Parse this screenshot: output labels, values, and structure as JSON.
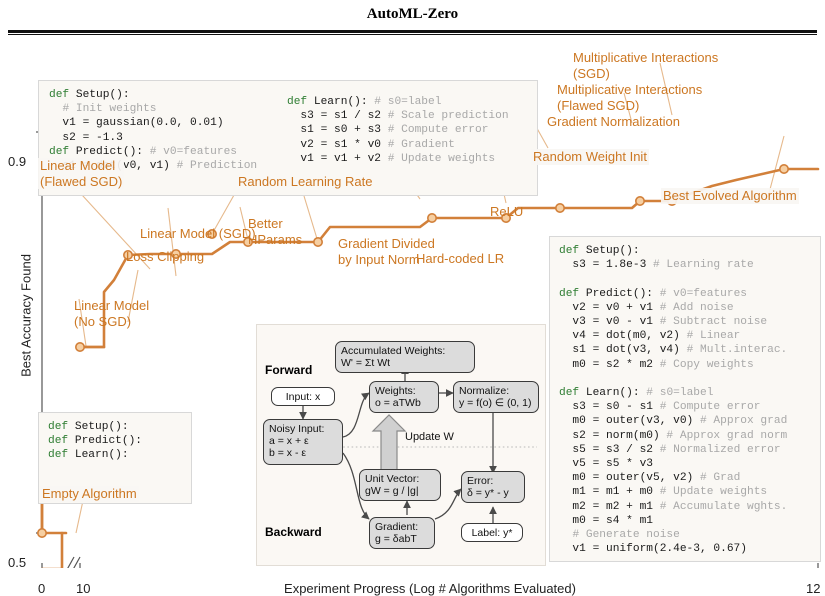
{
  "paper": {
    "title": "AutoML-Zero"
  },
  "axes": {
    "y_label": "Best Accuracy Found",
    "y_ticks": [
      "0.9",
      "0.5"
    ],
    "y_high": "0.9",
    "y_low": "0.5",
    "x_label": "Experiment Progress (Log # Algorithms Evaluated)",
    "x_tick_0": "0",
    "x_tick_10": "10",
    "x_tick_12": "12",
    "break_marker": "//"
  },
  "chart_data": {
    "type": "line",
    "title": "AutoML-Zero",
    "xlabel": "Experiment Progress (Log # Algorithms Evaluated)",
    "ylabel": "Best Accuracy Found",
    "xlim": [
      0,
      12
    ],
    "ylim": [
      0.5,
      0.9
    ],
    "grid": false,
    "legend": "none",
    "series": [
      {
        "name": "Best Accuracy Found",
        "color": "#d2803a",
        "x": [
          0.0,
          0.3,
          1.2,
          1.55,
          2.05,
          2.3,
          2.6,
          3.05,
          3.45,
          5.05,
          5.4,
          6.0,
          6.45,
          7.1,
          7.55,
          8.6,
          9.1,
          9.8,
          10.2,
          10.55,
          11.1,
          11.6,
          12.0
        ],
        "y": [
          0.5,
          0.5,
          0.618,
          0.618,
          0.66,
          0.672,
          0.735,
          0.735,
          0.736,
          0.736,
          0.759,
          0.759,
          0.773,
          0.773,
          0.781,
          0.781,
          0.806,
          0.83,
          0.838,
          0.845,
          0.845,
          0.87,
          0.87
        ],
        "markers_x": [
          0.0,
          1.2,
          2.05,
          2.3,
          2.6,
          5.05,
          6.0,
          7.1,
          8.6,
          9.1,
          9.8,
          10.55,
          11.1
        ],
        "markers_y": [
          0.5,
          0.618,
          0.66,
          0.672,
          0.735,
          0.736,
          0.759,
          0.773,
          0.781,
          0.806,
          0.83,
          0.845,
          0.87
        ]
      }
    ],
    "annotations": [
      "Linear Model (Flawed SGD)",
      "Linear Model (No SGD)",
      "Loss Clipping",
      "Linear Model (SGD)",
      "Better HParams",
      "Random Learning Rate",
      "Gradient Divided by Input Norm",
      "Hard-coded LR",
      "ReLU",
      "Random Weight Init",
      "Gradient Normalization",
      "Multiplicative Interactions (Flawed SGD)",
      "Multiplicative Interactions (SGD)",
      "Best Evolved Algorithm",
      "Empty Algorithm"
    ]
  },
  "annotations": {
    "linear_flawed_l1": "Linear Model",
    "linear_flawed_l2": "(Flawed SGD)",
    "linear_nosgd_l1": "Linear Model",
    "linear_nosgd_l2": "(No SGD)",
    "loss_clipping": "Loss Clipping",
    "linear_sgd": "Linear Model (SGD)",
    "better_hparams_l1": "Better",
    "better_hparams_l2": "HParams",
    "random_lr": "Random Learning Rate",
    "grad_div_l1": "Gradient Divided",
    "grad_div_l2": "by Input Norm",
    "hardcoded_lr": "Hard-coded LR",
    "relu": "ReLU",
    "random_weight_init": "Random Weight Init",
    "gradient_normalization": "Gradient Normalization",
    "mult_flawed_l1": "Multiplicative Interactions",
    "mult_flawed_l2": "(Flawed SGD)",
    "mult_sgd_l1": "Multiplicative Interactions",
    "mult_sgd_l2": "(SGD)",
    "best_evolved": "Best Evolved Algorithm",
    "empty_algorithm": "Empty Algorithm"
  },
  "code": {
    "top_left": "def Setup():\n  # Init weights\n  v1 = gaussian(0.0, 0.01)\n  s2 = -1.3\ndef Predict(): # v0=features\n  s1 = dot(v0, v1) # Prediction",
    "top_right": "def Learn(): # s0=label\n  s3 = s1 / s2 # Scale prediction\n  s1 = s0 + s3 # Compute error\n  v2 = s1 * v0 # Gradient\n  v1 = v1 + v2 # Update weights",
    "empty": "def Setup():\ndef Predict():\ndef Learn():",
    "best": "def Setup():\n  s3 = 1.8e-3 # Learning rate\n\ndef Predict(): # v0=features\n  v2 = v0 + v1 # Add noise\n  v3 = v0 - v1 # Subtract noise\n  v4 = dot(m0, v2) # Linear\n  s1 = dot(v3, v4) # Mult.interac.\n  m0 = s2 * m2 # Copy weights\n\ndef Learn(): # s0=label\n  s3 = s0 - s1 # Compute error\n  m0 = outer(v3, v0) # Approx grad\n  s2 = norm(m0) # Approx grad norm\n  s5 = s3 / s2 # Normalized error\n  v5 = s5 * v3\n  m0 = outer(v5, v2) # Grad\n  m1 = m1 + m0 # Update weights\n  m2 = m2 + m1 # Accumulate wghts.\n  m0 = s4 * m1\n  # Generate noise\n  v1 = uniform(2.4e-3, 0.67)"
  },
  "diagram": {
    "forward_label": "Forward",
    "backward_label": "Backward",
    "update_label": "Update W",
    "nodes": {
      "accumulated_weights_t": "Accumulated Weights:",
      "accumulated_weights_f": "W' = Σt Wt",
      "input": "Input: x",
      "noisy_t": "Noisy Input:",
      "noisy_f1": "a = x + ε",
      "noisy_f2": "b = x - ε",
      "weights_t": "Weights:",
      "weights_f": "o = aTWb",
      "normalize_t": "Normalize:",
      "normalize_f": "y = f(o) ∈ (0, 1)",
      "unit_vector_t": "Unit Vector:",
      "unit_vector_f": "gW = g / |g|",
      "error_t": "Error:",
      "error_f": "δ = y* - y",
      "gradient_t": "Gradient:",
      "gradient_f": "g = δabT",
      "label_t": "Label: y*"
    }
  },
  "colors": {
    "curve": "#d2803a",
    "marker_fill": "#f3c28a",
    "annotation_text": "#cc7722",
    "leader_line": "#e3b183",
    "keyword": "#2e7d32",
    "comment": "#a8a8a8"
  }
}
